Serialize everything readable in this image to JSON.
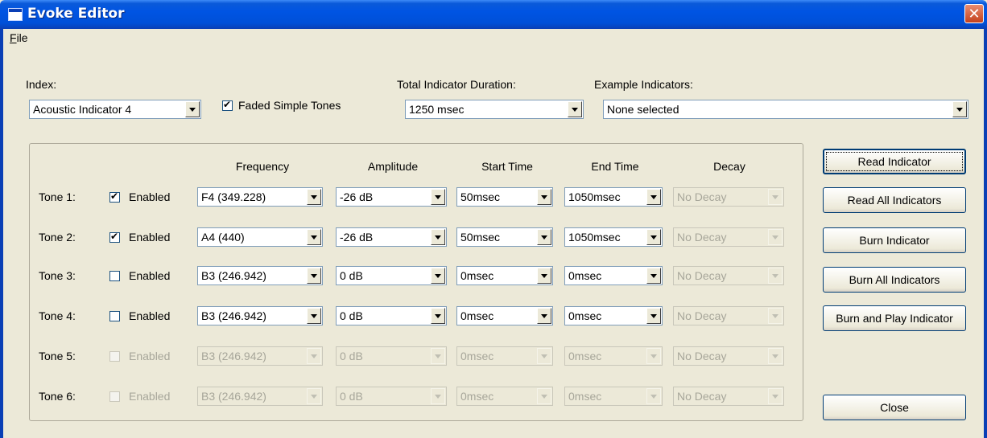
{
  "window": {
    "title": "Evoke Editor",
    "close_glyph": "✕"
  },
  "menu": {
    "file_initial": "F",
    "file_rest": "ile"
  },
  "top": {
    "index_label": "Index:",
    "index_value": "Acoustic Indicator 4",
    "faded_label": "Faded Simple Tones",
    "duration_label": "Total Indicator Duration:",
    "duration_value": "1250 msec",
    "examples_label": "Example Indicators:",
    "examples_value": "None selected"
  },
  "headers": {
    "frequency": "Frequency",
    "amplitude": "Amplitude",
    "start": "Start Time",
    "end": "End Time",
    "decay": "Decay"
  },
  "tones": [
    {
      "label": "Tone 1:",
      "enabled_label": "Enabled",
      "frequency": "F4 (349.228)",
      "amplitude": "-26 dB",
      "start": "50msec",
      "end": "1050msec",
      "decay": "No Decay"
    },
    {
      "label": "Tone 2:",
      "enabled_label": "Enabled",
      "frequency": "A4 (440)",
      "amplitude": "-26 dB",
      "start": "50msec",
      "end": "1050msec",
      "decay": "No Decay"
    },
    {
      "label": "Tone 3:",
      "enabled_label": "Enabled",
      "frequency": "B3 (246.942)",
      "amplitude": "0 dB",
      "start": "0msec",
      "end": "0msec",
      "decay": "No Decay"
    },
    {
      "label": "Tone 4:",
      "enabled_label": "Enabled",
      "frequency": "B3 (246.942)",
      "amplitude": "0 dB",
      "start": "0msec",
      "end": "0msec",
      "decay": "No Decay"
    },
    {
      "label": "Tone 5:",
      "enabled_label": "Enabled",
      "frequency": "B3 (246.942)",
      "amplitude": "0 dB",
      "start": "0msec",
      "end": "0msec",
      "decay": "No Decay"
    },
    {
      "label": "Tone 6:",
      "enabled_label": "Enabled",
      "frequency": "B3 (246.942)",
      "amplitude": "0 dB",
      "start": "0msec",
      "end": "0msec",
      "decay": "No Decay"
    }
  ],
  "buttons": {
    "read": "Read Indicator",
    "read_all": "Read All Indicators",
    "burn": "Burn Indicator",
    "burn_all": "Burn All Indicators",
    "burn_play": "Burn and Play Indicator",
    "close": "Close"
  }
}
